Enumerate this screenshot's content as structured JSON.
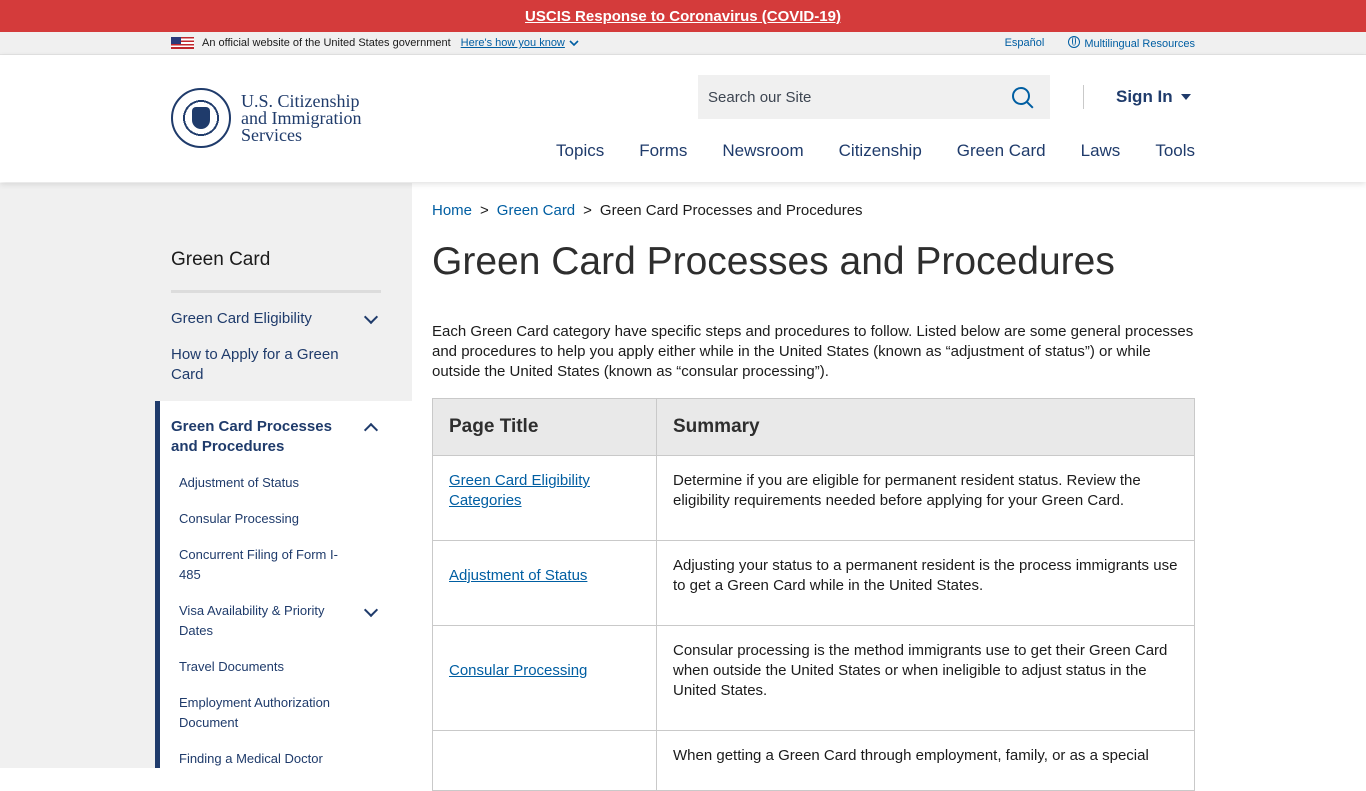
{
  "covid_banner": {
    "link": "USCIS Response to Coronavirus (COVID-19)"
  },
  "gov_banner": {
    "official": "An official website of the United States government",
    "how": "Here's how you know",
    "espanol": "Español",
    "multilingual": "Multilingual Resources"
  },
  "header": {
    "logo_lines": [
      "U.S. Citizenship",
      "and Immigration",
      "Services"
    ],
    "search_placeholder": "Search our Site",
    "sign_in": "Sign In",
    "nav": [
      "Topics",
      "Forms",
      "Newsroom",
      "Citizenship",
      "Green Card",
      "Laws",
      "Tools"
    ]
  },
  "sidebar": {
    "title": "Green Card",
    "items": [
      "Green Card Eligibility",
      "How to Apply for a Green Card",
      "Green Card Processes and Procedures"
    ],
    "subitems": [
      "Adjustment of Status",
      "Consular Processing",
      "Concurrent Filing of Form I-485",
      "Visa Availability & Priority Dates",
      "Travel Documents",
      "Employment Authorization Document",
      "Finding a Medical Doctor"
    ]
  },
  "breadcrumb": {
    "home": "Home",
    "section": "Green Card",
    "current": "Green Card Processes and Procedures",
    "separator": ">"
  },
  "main": {
    "title": "Green Card Processes and Procedures",
    "intro": "Each Green Card category have specific steps and procedures to follow. Listed below are some general processes and procedures to help you apply either while in the United States (known as “adjustment of status”) or while outside the United States (known as “consular processing”).",
    "table": {
      "headers": [
        "Page Title",
        "Summary"
      ],
      "rows": [
        {
          "title": "Green Card Eligibility Categories",
          "summary": "Determine if you are eligible for permanent resident status. Review the eligibility requirements needed before applying for your Green Card."
        },
        {
          "title": "Adjustment of Status",
          "summary": "Adjusting your status to a permanent resident is the process immigrants use to get a Green Card while in the United States."
        },
        {
          "title": "Consular Processing",
          "summary": "Consular processing is the method immigrants use to get their Green Card when outside the United States or when ineligible to adjust status in the United States."
        },
        {
          "title": "",
          "summary": "When getting a Green Card through employment, family, or as a special"
        }
      ]
    }
  },
  "colors": {
    "navy": "#1f3b6b",
    "link": "#005ea2",
    "banner_red": "#d43b3b"
  }
}
